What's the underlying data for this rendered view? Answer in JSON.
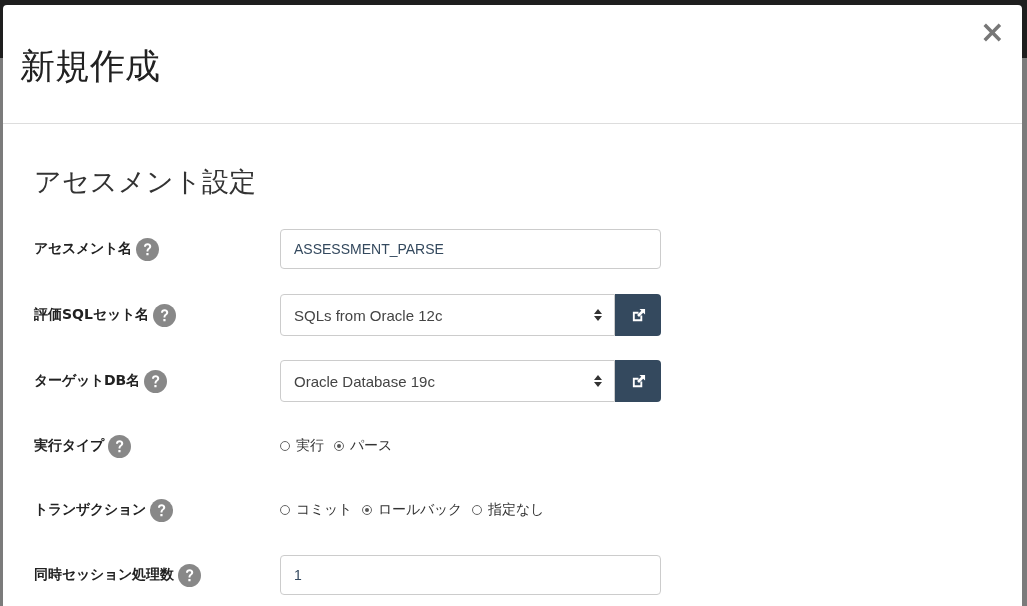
{
  "dialog": {
    "title": "新規作成",
    "close_label": "×",
    "section_title": "アセスメント設定",
    "fields": [
      {
        "kind": "text",
        "label": "アセスメント名",
        "value": "ASSESSMENT_PARSE"
      },
      {
        "kind": "select",
        "label": "評価SQLセット名",
        "value": "SQLs from Oracle 12c"
      },
      {
        "kind": "select",
        "label": "ターゲットDB名",
        "value": "Oracle Database 19c"
      },
      {
        "kind": "radio",
        "label": "実行タイプ",
        "options": [
          {
            "label": "実行",
            "selected": false
          },
          {
            "label": "パース",
            "selected": true
          }
        ]
      },
      {
        "kind": "radio",
        "label": "トランザクション",
        "options": [
          {
            "label": "コミット",
            "selected": false
          },
          {
            "label": "ロールバック",
            "selected": true
          },
          {
            "label": "指定なし",
            "selected": false
          }
        ]
      },
      {
        "kind": "text",
        "label": "同時セッション処理数",
        "value": "1"
      }
    ]
  }
}
